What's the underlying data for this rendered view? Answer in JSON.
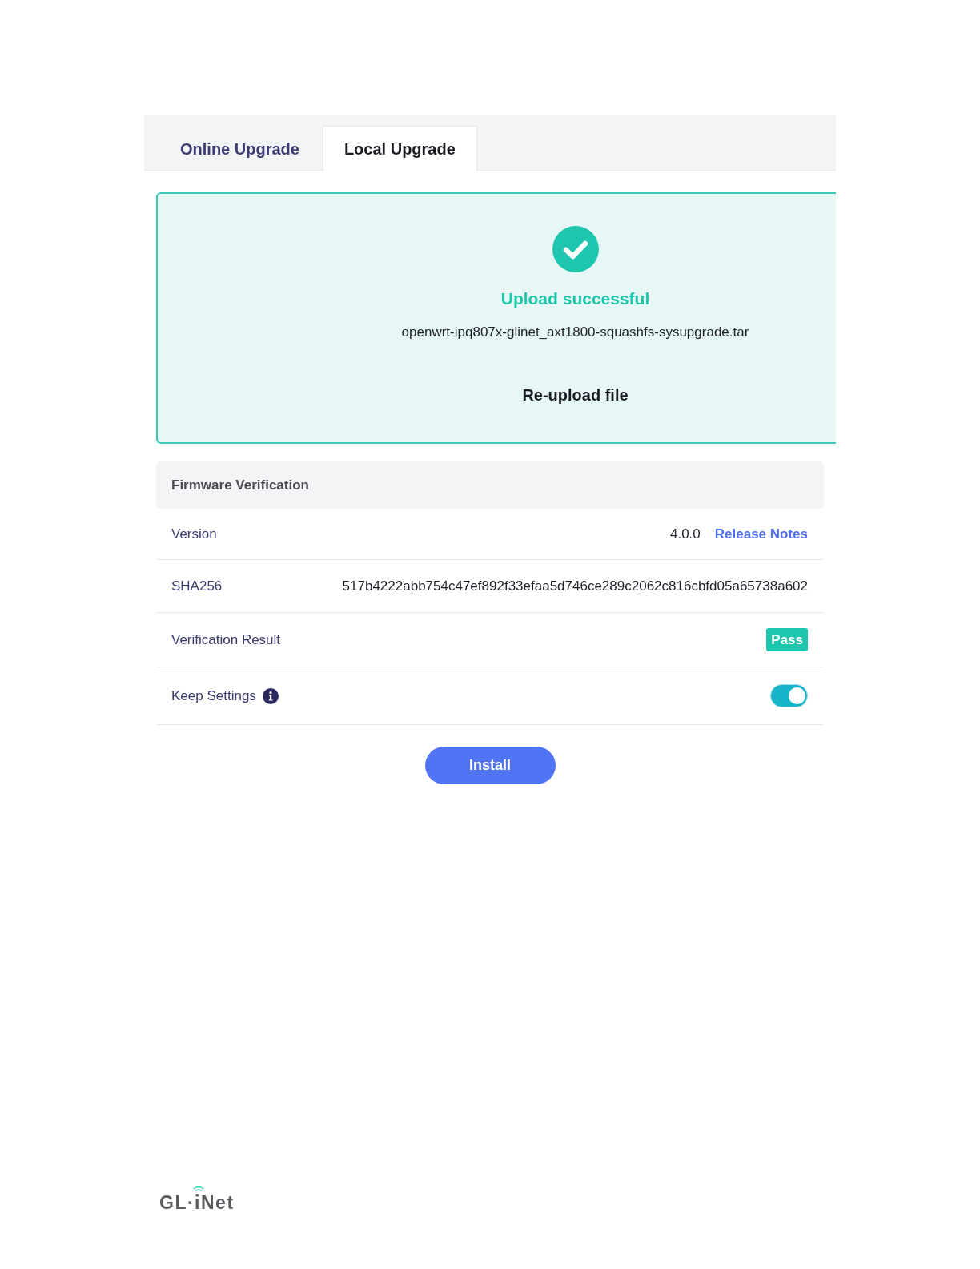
{
  "tabs": [
    {
      "label": "Online Upgrade",
      "selected": false
    },
    {
      "label": "Local Upgrade",
      "selected": true
    }
  ],
  "upload": {
    "status": "Upload successful",
    "filename": "openwrt-ipq807x-glinet_axt1800-squashfs-sysupgrade.tar",
    "action": "Re-upload file"
  },
  "verification": {
    "title": "Firmware Verification",
    "rows": [
      {
        "kind": "text",
        "label": "Version",
        "value": "4.0.0",
        "link": "Release Notes"
      },
      {
        "kind": "text",
        "label": "SHA256",
        "value": "517b4222abb754c47ef892f33efaa5d746ce289c2062c816cbfd05a65738a602"
      },
      {
        "kind": "badge",
        "label": "Verification Result",
        "value": "Pass"
      },
      {
        "kind": "toggle",
        "label": "Keep Settings",
        "info": true,
        "on": true
      }
    ]
  },
  "install_button": "Install",
  "logo": "GL·iNet"
}
